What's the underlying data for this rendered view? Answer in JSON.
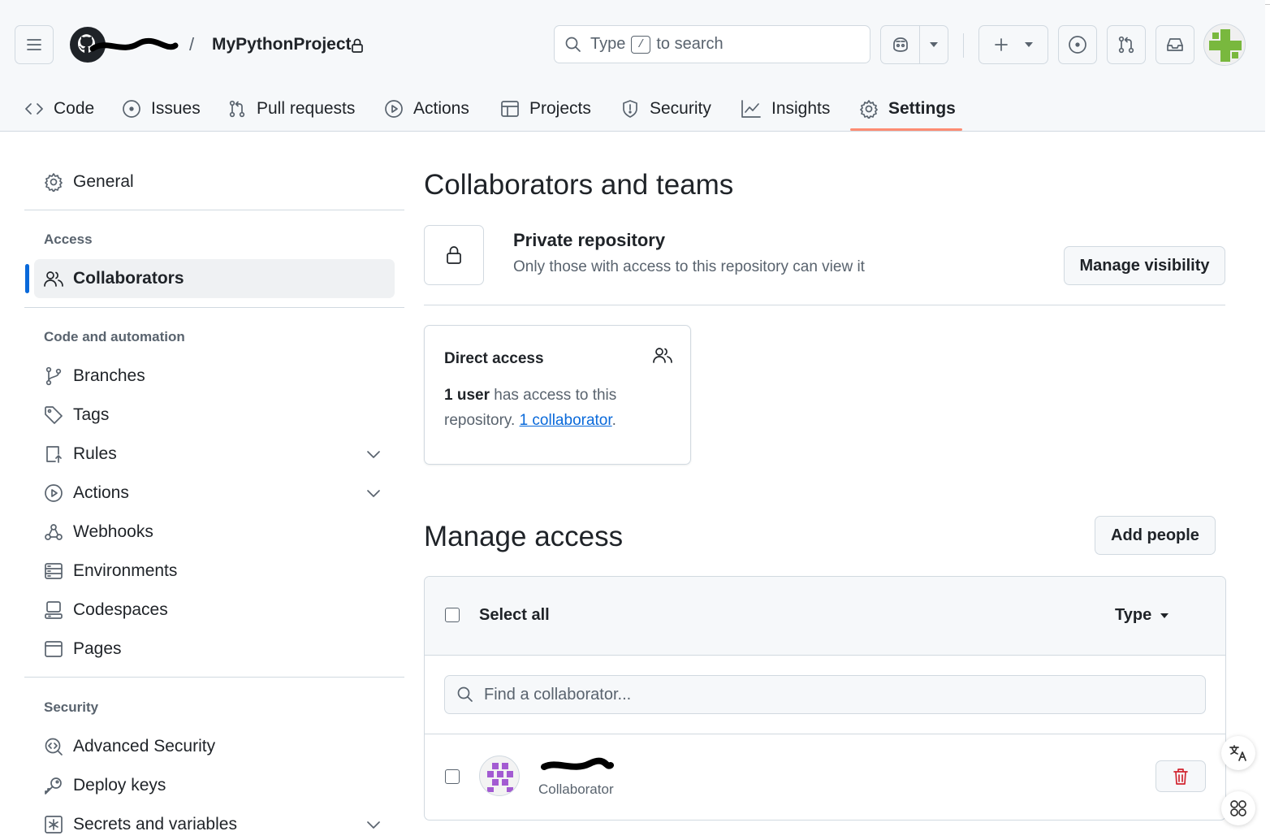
{
  "header": {
    "repo_name": "MyPythonProject",
    "separator": "/",
    "search": {
      "prefix": "Type",
      "key": "/",
      "suffix": "to search"
    }
  },
  "tabs": [
    {
      "label": "Code"
    },
    {
      "label": "Issues"
    },
    {
      "label": "Pull requests"
    },
    {
      "label": "Actions"
    },
    {
      "label": "Projects"
    },
    {
      "label": "Security"
    },
    {
      "label": "Insights"
    },
    {
      "label": "Settings",
      "active": true
    }
  ],
  "sidebar": {
    "general": "General",
    "sections": [
      {
        "heading": "Access",
        "items": [
          "Collaborators"
        ]
      },
      {
        "heading": "Code and automation",
        "items": [
          "Branches",
          "Tags",
          "Rules",
          "Actions",
          "Webhooks",
          "Environments",
          "Codespaces",
          "Pages"
        ]
      },
      {
        "heading": "Security",
        "items": [
          "Advanced Security",
          "Deploy keys",
          "Secrets and variables"
        ]
      }
    ]
  },
  "main": {
    "title": "Collaborators and teams",
    "private_repo": {
      "title": "Private repository",
      "description": "Only those with access to this repository can view it",
      "button": "Manage visibility"
    },
    "direct_access": {
      "title": "Direct access",
      "count": "1 user",
      "text_mid": " has access to this repository. ",
      "link": "1 collaborator",
      "text_end": "."
    },
    "manage_access": {
      "title": "Manage access",
      "add_button": "Add people",
      "select_all": "Select all",
      "type_filter": "Type",
      "find_placeholder": "Find a collaborator...",
      "collaborators": [
        {
          "role": "Collaborator"
        }
      ]
    }
  },
  "colors": {
    "accent": "#0969da",
    "tab_underline": "#fd8c73",
    "danger": "#d1242f"
  }
}
